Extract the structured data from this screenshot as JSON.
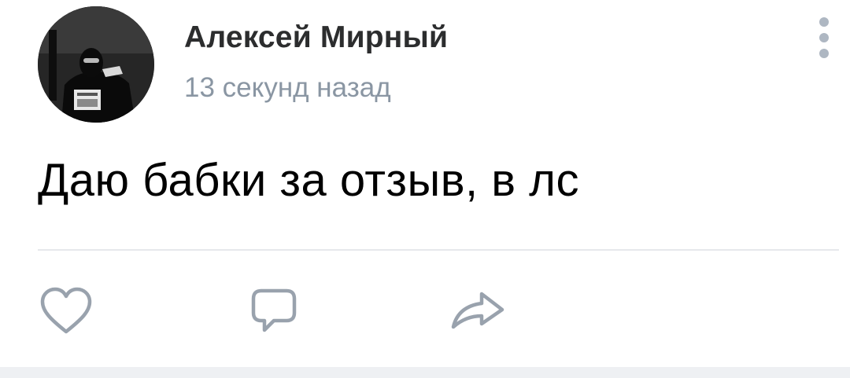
{
  "post": {
    "author_name": "Алексей Мирный",
    "time": "13 секунд назад",
    "text": "Даю бабки за отзыв, в лс"
  },
  "icons": {
    "like": "heart-icon",
    "comment": "comment-bubble-icon",
    "share": "share-arrow-icon",
    "menu": "more-vertical-icon"
  },
  "colors": {
    "author": "#2c2d2e",
    "time": "#8a96a3",
    "text": "#000000",
    "icon": "#99a2ad",
    "menu_dots": "#aeb7c2",
    "divider": "#e6e8ec"
  }
}
